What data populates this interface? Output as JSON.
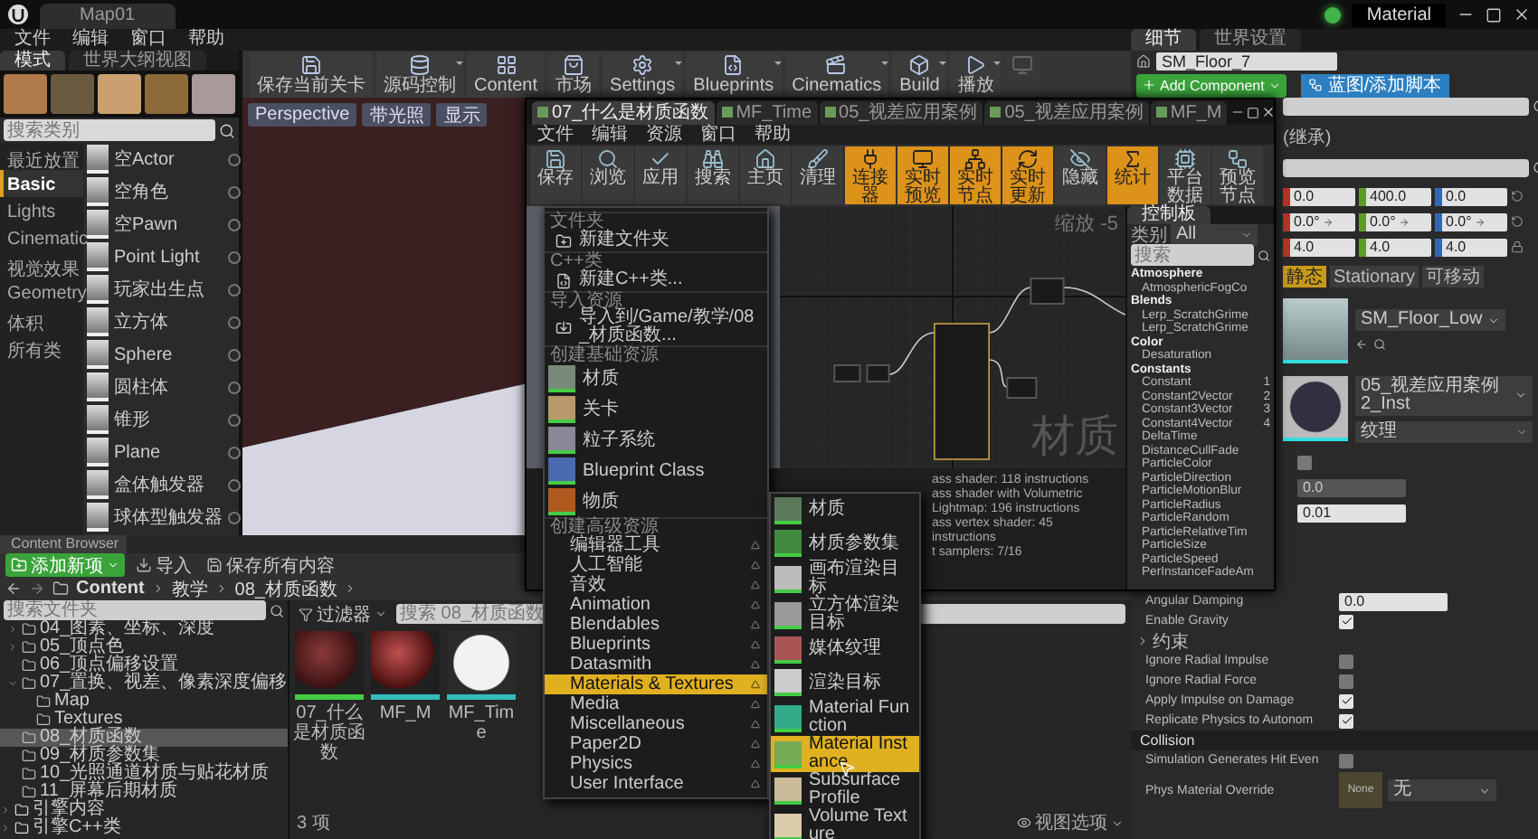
{
  "title_bar": {
    "tab": "Map01",
    "app_label": "Material"
  },
  "menu_bar": [
    "文件",
    "编辑",
    "窗口",
    "帮助"
  ],
  "modes_panel": {
    "tabs": [
      {
        "label": "模式",
        "selected": true
      },
      {
        "label": "世界大纲视图",
        "selected": false
      }
    ],
    "search": {
      "placeholder": "搜索类别"
    },
    "categories": [
      {
        "label": "最近放置",
        "selected": false
      },
      {
        "label": "Basic",
        "selected": true
      },
      {
        "label": "Lights",
        "selected": false
      },
      {
        "label": "Cinematic",
        "selected": false
      },
      {
        "label": "视觉效果",
        "selected": false
      },
      {
        "label": "Geometry",
        "selected": false
      },
      {
        "label": "体积",
        "selected": false
      },
      {
        "label": "所有类",
        "selected": false
      }
    ],
    "items": [
      "空Actor",
      "空角色",
      "空Pawn",
      "Point Light",
      "玩家出生点",
      "立方体",
      "Sphere",
      "圆柱体",
      "锥形",
      "Plane",
      "盒体触发器",
      "球体型触发器"
    ]
  },
  "toolbar": [
    {
      "label": "保存当前关卡",
      "has_menu": false
    },
    {
      "label": "源码控制",
      "has_menu": true
    },
    {
      "label": "Content",
      "has_menu": false
    },
    {
      "label": "市场",
      "has_menu": false
    },
    {
      "label": "Settings",
      "has_menu": true
    },
    {
      "label": "Blueprints",
      "has_menu": true
    },
    {
      "label": "Cinematics",
      "has_menu": true
    },
    {
      "label": "Build",
      "has_menu": true
    },
    {
      "label": "播放",
      "has_menu": true
    }
  ],
  "viewport": {
    "buttons": [
      "Perspective",
      "带光照",
      "显示"
    ]
  },
  "content_browser": {
    "tab": "Content Browser",
    "add_button": "添加新项",
    "import_button": "导入",
    "save_all_button": "保存所有内容",
    "path": [
      "Content",
      "教学",
      "08_材质函数"
    ],
    "tree_search": {
      "placeholder": "搜索文件夹"
    },
    "tree": [
      {
        "label": "04_图素、坐标、深度",
        "kind": "folder",
        "expanded": false,
        "selected": false
      },
      {
        "label": "05_顶点色",
        "kind": "folder",
        "expanded": false,
        "selected": false
      },
      {
        "label": "06_顶点偏移设置",
        "kind": "folder",
        "selected": false
      },
      {
        "label": "07_置换、视差、像素深度偏移",
        "kind": "folder",
        "expanded": true,
        "selected": false,
        "children": [
          {
            "label": "Map",
            "kind": "folder",
            "selected": false
          },
          {
            "label": "Textures",
            "kind": "folder",
            "selected": false
          }
        ]
      },
      {
        "label": "08_材质函数",
        "kind": "folder",
        "selected": true
      },
      {
        "label": "09_材质参数集",
        "kind": "folder",
        "selected": false
      },
      {
        "label": "10_光照通道材质与贴花材质",
        "kind": "folder",
        "selected": false
      },
      {
        "label": "11_屏幕后期材质",
        "kind": "folder",
        "selected": false
      },
      {
        "label": "引擎内容",
        "kind": "root",
        "expanded": false,
        "selected": false
      },
      {
        "label": "引擎C++类",
        "kind": "root",
        "expanded": false,
        "selected": false
      }
    ],
    "filter_button": "过滤器",
    "asset_search": {
      "placeholder": "搜索 08_材质函数"
    },
    "assets": [
      {
        "name": "07_什么是材质函数",
        "kind": "rough"
      },
      {
        "name": "MF_M",
        "kind": "glossy"
      },
      {
        "name": "MF_Time",
        "kind": "blank"
      }
    ],
    "item_count": "3 项",
    "view_options": "视图选项"
  },
  "details": {
    "tabs": [
      {
        "label": "细节",
        "selected": true
      },
      {
        "label": "世界设置",
        "selected": false
      }
    ],
    "name": "SM_Floor_7",
    "add_component": "Add Component",
    "blueprint_button": "蓝图/添加脚本",
    "inherited": "(继承)",
    "axes": [
      {
        "color": "#b8332a"
      },
      {
        "color": "#5f9b2a"
      },
      {
        "color": "#3465b8"
      }
    ],
    "transform": [
      {
        "kind": "plain",
        "values": [
          "0.0",
          "400.0",
          "0.0"
        ]
      },
      {
        "kind": "spin",
        "values": [
          "0.0°",
          "0.0°",
          "0.0°"
        ]
      },
      {
        "kind": "plain",
        "values": [
          "4.0",
          "4.0",
          "4.0"
        ]
      }
    ],
    "mobility": [
      {
        "label": "静态",
        "selected": true
      },
      {
        "label": "Stationary",
        "selected": false
      },
      {
        "label": "可移动",
        "selected": false
      }
    ],
    "static_mesh": "SM_Floor_Low",
    "material": {
      "value": "05_视差应用案例2_Inst",
      "slot": "纹理"
    },
    "physics_rows": [
      {
        "kind": "check",
        "checked": false
      },
      {
        "kind": "number",
        "value": "0.0",
        "disabled": true
      },
      {
        "kind": "number",
        "value": "0.01",
        "disabled": false
      },
      {
        "kind": "number",
        "label": "Angular Damping",
        "value": "0.0",
        "disabled": false
      },
      {
        "kind": "check",
        "label": "Enable Gravity",
        "checked": true
      },
      {
        "kind": "group",
        "label": "约束"
      },
      {
        "kind": "check",
        "label": "Ignore Radial Impulse",
        "checked": false
      },
      {
        "kind": "check",
        "label": "Ignore Radial Force",
        "checked": false
      },
      {
        "kind": "check",
        "label": "Apply Impulse on Damage",
        "checked": true
      },
      {
        "kind": "check",
        "label": "Replicate Physics to Autonom",
        "checked": true
      }
    ],
    "collision": {
      "title": "Collision",
      "rows": [
        {
          "kind": "check",
          "label": "Simulation Generates Hit Even",
          "checked": false
        },
        {
          "kind": "asset",
          "label": "Phys Material Override",
          "thumbnail": "None",
          "value": "无"
        }
      ]
    }
  },
  "material_editor": {
    "tabs": [
      {
        "label": "07_什么是材质函数",
        "selected": true
      },
      {
        "label": "MF_Time",
        "selected": false
      },
      {
        "label": "05_视差应用案例",
        "selected": false
      },
      {
        "label": "05_视差应用案例",
        "selected": false
      },
      {
        "label": "MF_M",
        "selected": false
      }
    ],
    "menu": [
      "文件",
      "编辑",
      "资源",
      "窗口",
      "帮助"
    ],
    "toolbar": [
      {
        "label": "保存",
        "active": false
      },
      {
        "label": "浏览",
        "active": false
      },
      {
        "label": "应用",
        "active": false
      },
      {
        "label": "搜索",
        "active": false
      },
      {
        "label": "主页",
        "active": false
      },
      {
        "label": "清理",
        "active": false
      },
      {
        "label": "连接器",
        "active": true
      },
      {
        "label": "实时预览",
        "active": true
      },
      {
        "label": "实时节点",
        "active": true
      },
      {
        "label": "实时更新",
        "active": true
      },
      {
        "label": "隐藏",
        "active": false
      },
      {
        "label": "统计",
        "active": true
      },
      {
        "label": "平台数据",
        "active": false
      },
      {
        "label": "预览节点",
        "active": false
      }
    ],
    "zoom_label": "缩放 -5",
    "graph_watermark": "材质",
    "stats": [
      "ass shader: 118 instructions",
      "ass shader with Volumetric Lightmap: 196 instructions",
      "ass vertex shader: 45 instructions",
      "t samplers: 7/16"
    ],
    "palette": {
      "tab": "控制板",
      "category_label": "类别",
      "category": "All",
      "search": {
        "placeholder": "搜索"
      },
      "entries": [
        {
          "kind": "category",
          "label": "Atmosphere"
        },
        {
          "kind": "node",
          "label": "AtmosphericFogCo"
        },
        {
          "kind": "category",
          "label": "Blends"
        },
        {
          "kind": "node",
          "label": "Lerp_ScratchGrime"
        },
        {
          "kind": "node",
          "label": "Lerp_ScratchGrime"
        },
        {
          "kind": "category",
          "label": "Color"
        },
        {
          "kind": "node",
          "label": "Desaturation"
        },
        {
          "kind": "category",
          "label": "Constants"
        },
        {
          "kind": "node",
          "label": "Constant",
          "key": "1"
        },
        {
          "kind": "node",
          "label": "Constant2Vector",
          "key": "2"
        },
        {
          "kind": "node",
          "label": "Constant3Vector",
          "key": "3"
        },
        {
          "kind": "node",
          "label": "Constant4Vector",
          "key": "4"
        },
        {
          "kind": "node",
          "label": "DeltaTime"
        },
        {
          "kind": "node",
          "label": "DistanceCullFade"
        },
        {
          "kind": "node",
          "label": "ParticleColor"
        },
        {
          "kind": "node",
          "label": "ParticleDirection"
        },
        {
          "kind": "node",
          "label": "ParticleMotionBlur"
        },
        {
          "kind": "node",
          "label": "ParticleRadius"
        },
        {
          "kind": "node",
          "label": "ParticleRandom"
        },
        {
          "kind": "node",
          "label": "ParticleRelativeTim"
        },
        {
          "kind": "node",
          "label": "ParticleSize"
        },
        {
          "kind": "node",
          "label": "ParticleSpeed"
        },
        {
          "kind": "node",
          "label": "PerInstanceFadeAm"
        }
      ]
    }
  },
  "context_menu": {
    "sections": [
      {
        "header": "文件夹",
        "items": [
          {
            "label": "新建文件夹",
            "kind": "action",
            "selected": false
          }
        ]
      },
      {
        "header": "C++类",
        "items": [
          {
            "label": "新建C++类...",
            "kind": "action",
            "selected": false
          }
        ]
      },
      {
        "header": "导入资源",
        "items": [
          {
            "label": "导入到/Game/教学/08_材质函数...",
            "kind": "action",
            "selected": false
          }
        ]
      },
      {
        "header": "创建基础资源",
        "items": [
          {
            "label": "材质",
            "kind": "asset",
            "selected": false
          },
          {
            "label": "关卡",
            "kind": "asset",
            "selected": false
          },
          {
            "label": "粒子系统",
            "kind": "asset",
            "selected": false
          },
          {
            "label": "Blueprint Class",
            "kind": "asset",
            "selected": false
          },
          {
            "label": "物质",
            "kind": "asset",
            "selected": false
          }
        ]
      },
      {
        "header": "创建高级资源",
        "items": [
          {
            "label": "编辑器工具",
            "kind": "submenu",
            "selected": false
          },
          {
            "label": "人工智能",
            "kind": "submenu",
            "selected": false
          },
          {
            "label": "音效",
            "kind": "submenu",
            "selected": false
          },
          {
            "label": "Animation",
            "kind": "submenu",
            "selected": false
          },
          {
            "label": "Blendables",
            "kind": "submenu",
            "selected": false
          },
          {
            "label": "Blueprints",
            "kind": "submenu",
            "selected": false
          },
          {
            "label": "Datasmith",
            "kind": "submenu",
            "selected": false
          },
          {
            "label": "Materials & Textures",
            "kind": "submenu",
            "selected": true
          },
          {
            "label": "Media",
            "kind": "submenu",
            "selected": false
          },
          {
            "label": "Miscellaneous",
            "kind": "submenu",
            "selected": false
          },
          {
            "label": "Paper2D",
            "kind": "submenu",
            "selected": false
          },
          {
            "label": "Physics",
            "kind": "submenu",
            "selected": false
          },
          {
            "label": "User Interface",
            "kind": "submenu",
            "selected": false
          }
        ]
      }
    ]
  },
  "submenu": {
    "items": [
      {
        "label": "材质",
        "selected": false
      },
      {
        "label": "材质参数集",
        "selected": false
      },
      {
        "label": "画布渲染目标",
        "selected": false
      },
      {
        "label": "立方体渲染目标",
        "selected": false
      },
      {
        "label": "媒体纹理",
        "selected": false
      },
      {
        "label": "渲染目标",
        "selected": false
      },
      {
        "label": "Material Function",
        "selected": false
      },
      {
        "label": "Material Instance",
        "selected": true
      },
      {
        "label": "Subsurface Profile",
        "selected": false
      },
      {
        "label": "Volume Texture",
        "selected": false
      }
    ]
  }
}
